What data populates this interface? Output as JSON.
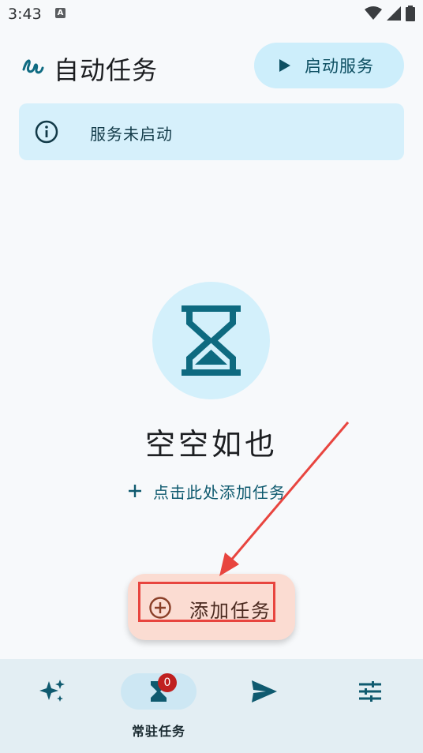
{
  "status_bar": {
    "time": "3:43",
    "notification_letter": "A"
  },
  "app_bar": {
    "title": "自动任务",
    "start_button": {
      "label": "启动服务",
      "icon": "play-icon"
    }
  },
  "banner": {
    "icon": "info-icon",
    "text": "服务未启动"
  },
  "empty_state": {
    "icon": "hourglass-icon",
    "title": "空空如也",
    "add_link": {
      "icon": "plus-icon",
      "label": "点击此处添加任务"
    }
  },
  "fab": {
    "icon": "add-circle-icon",
    "label": "添加任务"
  },
  "bottom_nav": {
    "items": [
      {
        "name": "sparkle",
        "icon": "sparkles-icon",
        "label": "",
        "active": false
      },
      {
        "name": "resident-tasks",
        "icon": "hourglass-icon",
        "label": "常驻任务",
        "active": true,
        "badge": "0"
      },
      {
        "name": "send",
        "icon": "send-icon",
        "label": "",
        "active": false
      },
      {
        "name": "settings",
        "icon": "sliders-icon",
        "label": "",
        "active": false
      }
    ]
  },
  "colors": {
    "primary": "#0f6b82",
    "primary_container": "#cdeefb",
    "fab_container": "#fbdcd2",
    "annotation_red": "#e8453f",
    "badge_red": "#c0201f"
  }
}
